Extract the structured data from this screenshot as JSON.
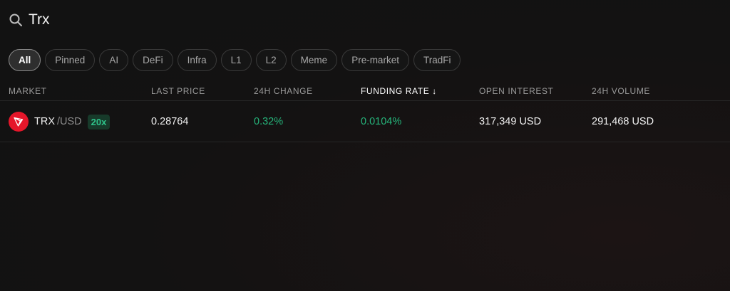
{
  "search": {
    "value": "Trx",
    "icon": "search-icon"
  },
  "filters": [
    {
      "label": "All",
      "active": true
    },
    {
      "label": "Pinned",
      "active": false
    },
    {
      "label": "AI",
      "active": false
    },
    {
      "label": "DeFi",
      "active": false
    },
    {
      "label": "Infra",
      "active": false
    },
    {
      "label": "L1",
      "active": false
    },
    {
      "label": "L2",
      "active": false
    },
    {
      "label": "Meme",
      "active": false
    },
    {
      "label": "Pre-market",
      "active": false
    },
    {
      "label": "TradFi",
      "active": false
    }
  ],
  "table": {
    "columns": {
      "market": "MARKET",
      "last_price": "LAST PRICE",
      "change_24h": "24H CHANGE",
      "funding_rate": "FUNDING RATE ↓",
      "open_interest": "OPEN INTEREST",
      "volume_24h": "24H VOLUME"
    },
    "sorted_column": "funding_rate",
    "rows": [
      {
        "base": "TRX",
        "quote": "/USD",
        "leverage": "20x",
        "icon": "tron-icon",
        "last_price": "0.28764",
        "change_24h": "0.32%",
        "funding_rate": "0.0104%",
        "open_interest": "317,349 USD",
        "volume_24h": "291,468 USD"
      }
    ]
  },
  "colors": {
    "positive": "#26b57b",
    "tron_red": "#e5162a",
    "background": "#121212"
  }
}
